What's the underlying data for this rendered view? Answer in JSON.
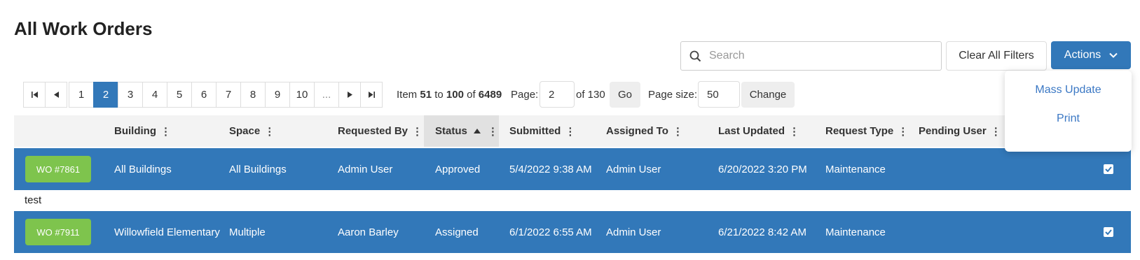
{
  "page": {
    "title": "All Work Orders"
  },
  "search": {
    "placeholder": "Search",
    "value": ""
  },
  "toolbar": {
    "clear_filters_label": "Clear All Filters",
    "actions_label": "Actions"
  },
  "actions_menu": {
    "items": [
      "Mass Update",
      "Print"
    ]
  },
  "pagination": {
    "pages": [
      "1",
      "2",
      "3",
      "4",
      "5",
      "6",
      "7",
      "8",
      "9",
      "10",
      "..."
    ],
    "current_page": "2",
    "item_prefix": "Item",
    "item_start": "51",
    "item_to": "to",
    "item_end": "100",
    "item_of": "of",
    "item_total": "6489",
    "page_label": "Page:",
    "page_value": "2",
    "of_pages": "of 130",
    "go_label": "Go",
    "page_size_label": "Page size:",
    "page_size_value": "50",
    "change_label": "Change"
  },
  "table": {
    "columns": [
      "Building",
      "Space",
      "Requested By",
      "Status",
      "Submitted",
      "Assigned To",
      "Last Updated",
      "Request Type",
      "Pending User"
    ],
    "sorted_column": "Status",
    "sort_direction": "ascending",
    "rows": [
      {
        "wo": "WO #7861",
        "building": "All Buildings",
        "space": "All Buildings",
        "requested_by": "Admin User",
        "status": "Approved",
        "submitted": "5/4/2022 9:38 AM",
        "assigned_to": "Admin User",
        "last_updated": "6/20/2022 3:20 PM",
        "request_type": "Maintenance",
        "pending_user": "",
        "checked": true,
        "note": "test"
      },
      {
        "wo": "WO #7911",
        "building": "Willowfield Elementary",
        "space": "Multiple",
        "requested_by": "Aaron Barley",
        "status": "Assigned",
        "submitted": "6/1/2022 6:55 AM",
        "assigned_to": "Admin User",
        "last_updated": "6/21/2022 8:42 AM",
        "request_type": "Maintenance",
        "pending_user": "",
        "checked": true
      }
    ]
  },
  "colors": {
    "primary": "#3278b9",
    "badge_green": "#7ec44d",
    "link_blue": "#3b78c4",
    "header_bg": "#f3f3f3"
  }
}
